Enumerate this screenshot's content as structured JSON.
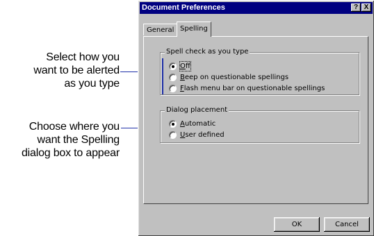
{
  "callouts": {
    "alert": {
      "line1": "Select how you",
      "line2": "want to be alerted",
      "line3": "as you type"
    },
    "placement": {
      "line1": "Choose where you",
      "line2": "want the Spelling",
      "line3": "dialog box to appear"
    }
  },
  "dialog": {
    "title": "Document Preferences",
    "help_button": "?",
    "close_button": "X",
    "tabs": [
      {
        "label": "General",
        "active": false
      },
      {
        "label": "Spelling",
        "active": true
      }
    ],
    "spell_group": {
      "legend": "Spell check as you type",
      "options": [
        {
          "key": "O",
          "rest": "ff",
          "checked": true
        },
        {
          "key": "B",
          "rest": "eep on questionable spellings",
          "checked": false
        },
        {
          "key": "F",
          "rest": "lash menu bar on questionable spellings",
          "checked": false
        }
      ]
    },
    "placement_group": {
      "legend": "Dialog placement",
      "options": [
        {
          "key": "A",
          "rest": "utomatic",
          "checked": true
        },
        {
          "key": "U",
          "rest": "ser defined",
          "checked": false
        }
      ]
    },
    "ok_label": "OK",
    "cancel_label": "Cancel"
  }
}
